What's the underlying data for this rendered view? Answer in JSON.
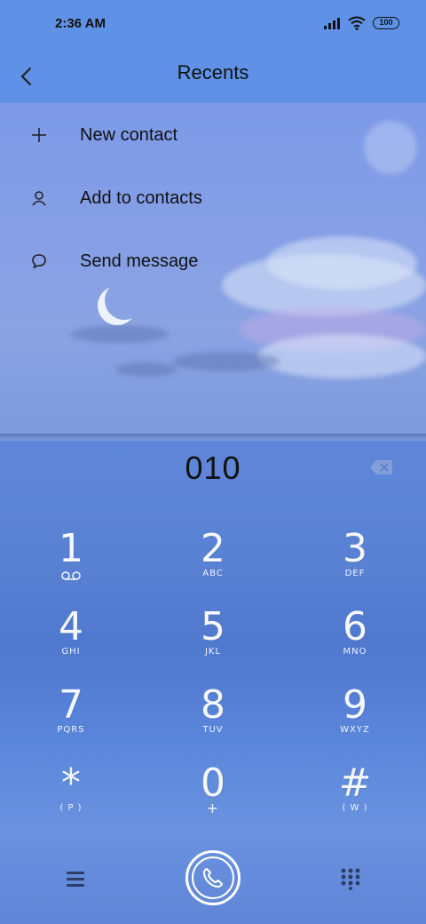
{
  "status": {
    "time": "2:36 AM",
    "battery": "100"
  },
  "header": {
    "title": "Recents"
  },
  "menu": [
    {
      "label": "New contact",
      "icon": "plus-icon"
    },
    {
      "label": "Add to contacts",
      "icon": "person-icon"
    },
    {
      "label": "Send message",
      "icon": "message-icon"
    }
  ],
  "dialer": {
    "number": "010",
    "keys": [
      {
        "digit": "1",
        "letters": ""
      },
      {
        "digit": "2",
        "letters": "ABC"
      },
      {
        "digit": "3",
        "letters": "DEF"
      },
      {
        "digit": "4",
        "letters": "GHI"
      },
      {
        "digit": "5",
        "letters": "JKL"
      },
      {
        "digit": "6",
        "letters": "MNO"
      },
      {
        "digit": "7",
        "letters": "PQRS"
      },
      {
        "digit": "8",
        "letters": "TUV"
      },
      {
        "digit": "9",
        "letters": "WXYZ"
      },
      {
        "digit": "*",
        "letters": "( P )"
      },
      {
        "digit": "0",
        "letters": "+"
      },
      {
        "digit": "#",
        "letters": "( W )"
      }
    ]
  },
  "colors": {
    "accent": "#5f92e6",
    "text": "#111111",
    "key_text": "#f6f8fd"
  }
}
